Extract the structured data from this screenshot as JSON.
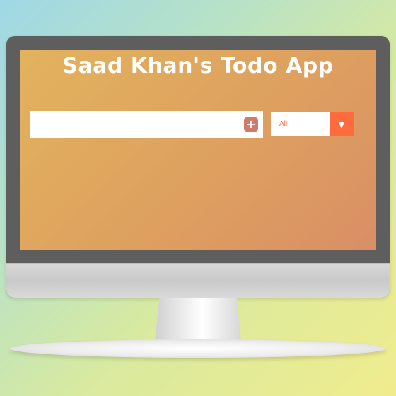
{
  "app": {
    "title": "Saad Khan's Todo App"
  },
  "todo_input": {
    "value": "",
    "placeholder": "",
    "add_button_label": "+"
  },
  "filter": {
    "selected": "All",
    "arrow_icon": "triangle-down-icon"
  },
  "colors": {
    "screen_gradient_start": "#e2b35e",
    "screen_gradient_end": "#d98f66",
    "add_button": "#d07a6a",
    "filter_accent": "#ff6b3d",
    "title_text": "#ffffff"
  }
}
